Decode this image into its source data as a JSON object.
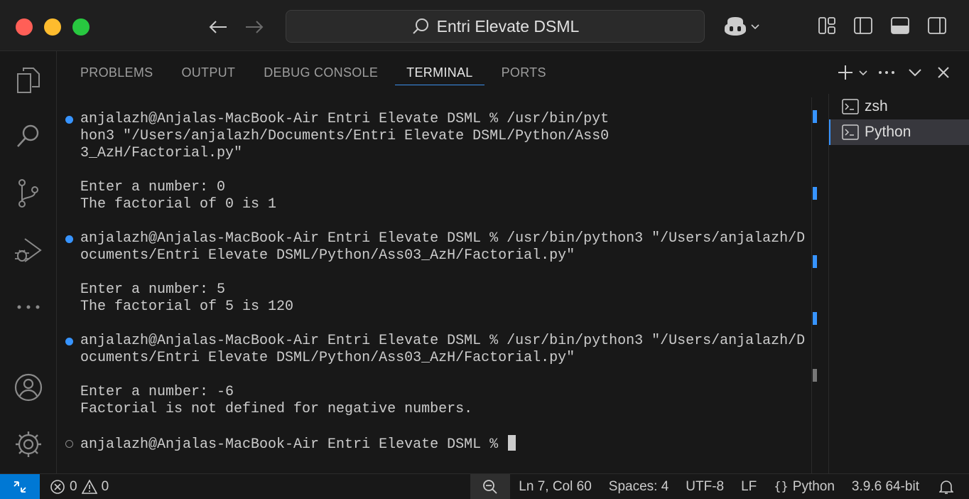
{
  "titlebar": {
    "search_text": "Entri Elevate DSML"
  },
  "panel": {
    "tabs": [
      {
        "label": "PROBLEMS"
      },
      {
        "label": "OUTPUT"
      },
      {
        "label": "DEBUG CONSOLE"
      },
      {
        "label": "TERMINAL",
        "active": true
      },
      {
        "label": "PORTS"
      }
    ]
  },
  "terminal": {
    "lines": [
      "anjalazh@Anjalas-MacBook-Air Entri Elevate DSML % /usr/bin/pyt",
      "hon3 \"/Users/anjalazh/Documents/Entri Elevate DSML/Python/Ass0",
      "3_AzH/Factorial.py\"",
      "Enter a number: 0",
      "The factorial of 0 is 1",
      "anjalazh@Anjalas-MacBook-Air Entri Elevate DSML % /usr/bin/python3 \"/Users/anjalazh/D",
      "ocuments/Entri Elevate DSML/Python/Ass03_AzH/Factorial.py\"",
      "Enter a number: 5",
      "The factorial of 5 is 120",
      "anjalazh@Anjalas-MacBook-Air Entri Elevate DSML % /usr/bin/python3 \"/Users/anjalazh/D",
      "ocuments/Entri Elevate DSML/Python/Ass03_AzH/Factorial.py\"",
      "Enter a number: -6",
      "Factorial is not defined for negative numbers.",
      "anjalazh@Anjalas-MacBook-Air Entri Elevate DSML % "
    ]
  },
  "terminal_list": {
    "items": [
      {
        "label": "zsh"
      },
      {
        "label": "Python",
        "active": true
      }
    ]
  },
  "statusbar": {
    "errors": "0",
    "warnings": "0",
    "position": "Ln 7, Col 60",
    "spaces": "Spaces: 4",
    "encoding": "UTF-8",
    "eol": "LF",
    "language": "Python",
    "interpreter": "3.9.6 64-bit"
  },
  "colors": {
    "accent": "#0078d4",
    "decoration_blue": "#3794ff"
  }
}
